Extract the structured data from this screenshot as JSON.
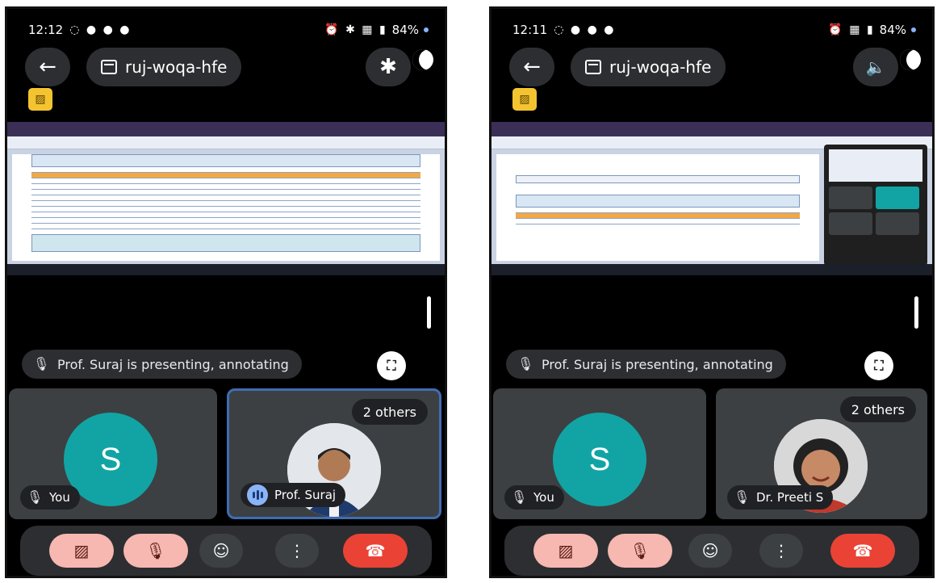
{
  "left": {
    "status": {
      "time": "12:12",
      "battery": "84%"
    },
    "meeting_code": "ruj-woqa-hfe",
    "presenting_text": "Prof. Suraj is presenting, annotating",
    "tiles": [
      {
        "avatar_letter": "S",
        "name": "You"
      },
      {
        "name": "Prof. Suraj",
        "others": "2 others"
      }
    ]
  },
  "right": {
    "status": {
      "time": "12:11",
      "battery": "84%"
    },
    "meeting_code": "ruj-woqa-hfe",
    "presenting_text": "Prof. Suraj is presenting, annotating",
    "tiles": [
      {
        "avatar_letter": "S",
        "name": "You"
      },
      {
        "name": "Dr. Preeti S",
        "others": "2 others"
      }
    ]
  },
  "icons": {
    "back": "←",
    "bluetooth": "✱",
    "speaker": "🔈",
    "mic_off": "🎙",
    "fullscreen": "⛶",
    "camera_off": "▨",
    "emoji": "☺",
    "more": "⋮",
    "hang_up": "☎"
  },
  "colors": {
    "accent_teal": "#12a4a4",
    "hangup_red": "#ea4335",
    "muted_pink": "#f6b8b0",
    "active_border": "#3f6db3"
  }
}
